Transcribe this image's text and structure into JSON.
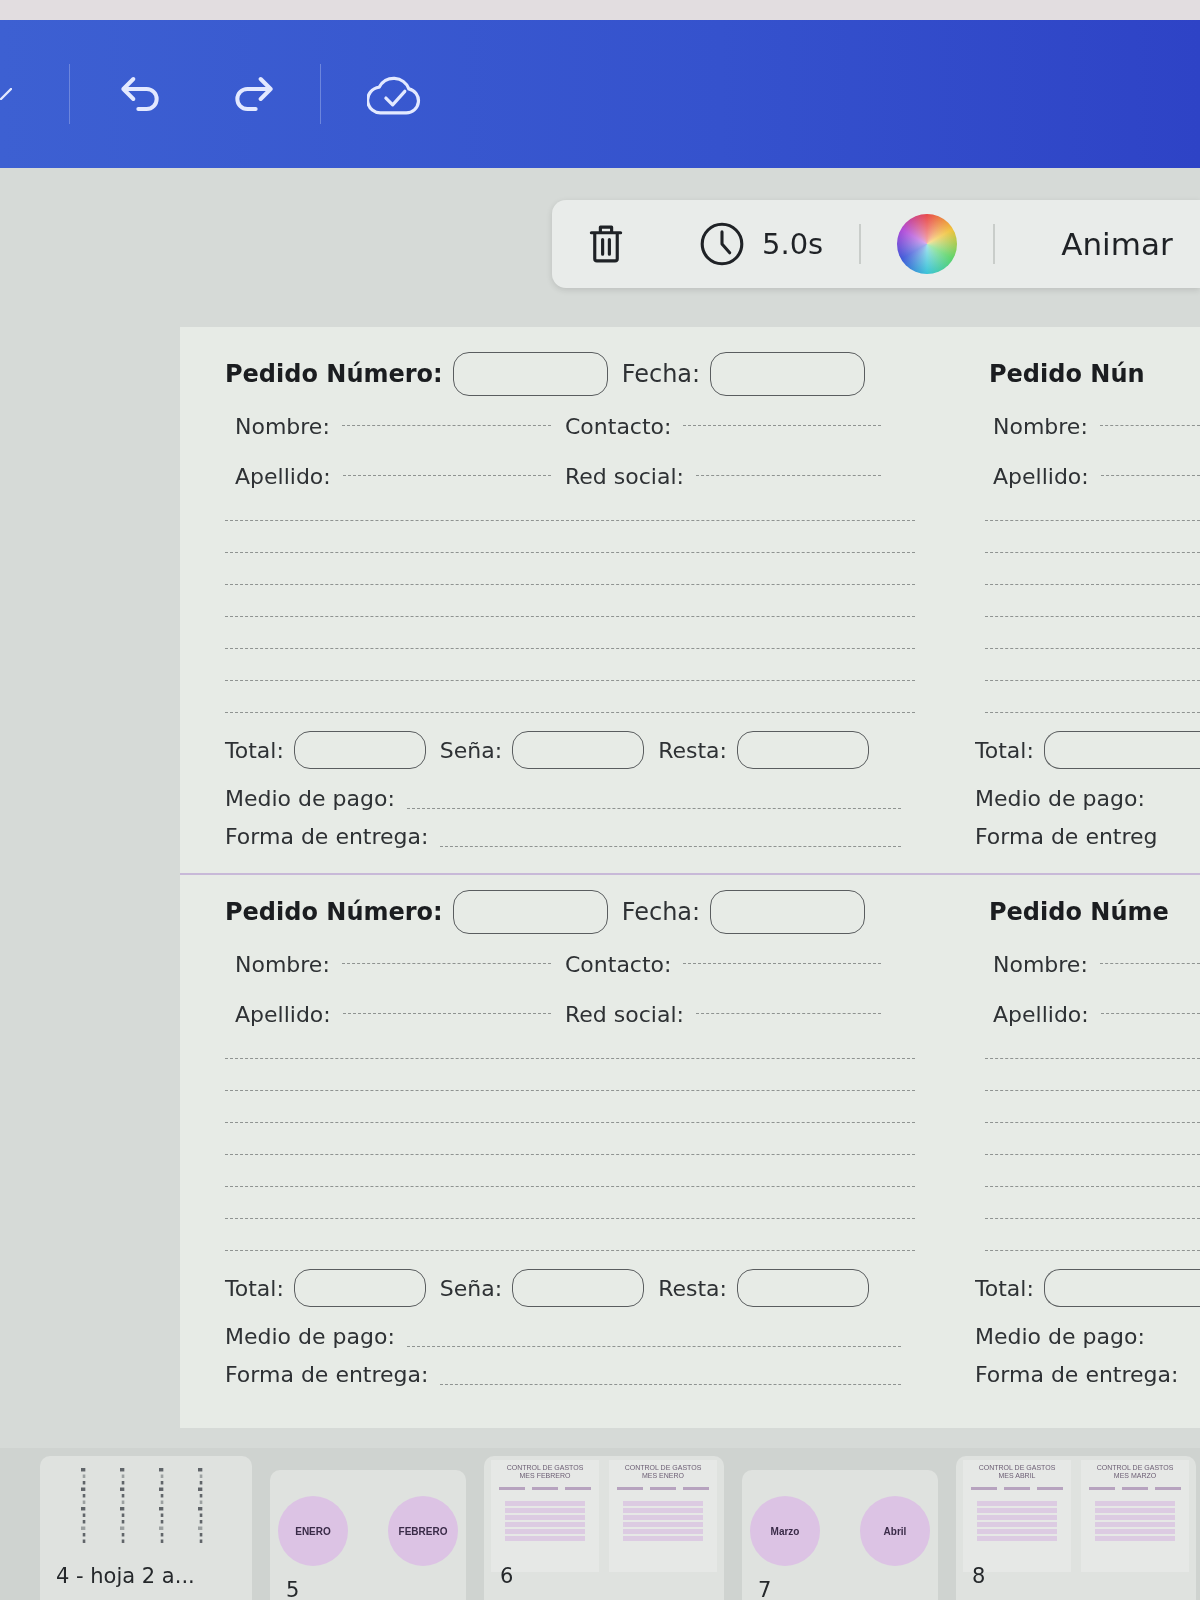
{
  "toolbar": {
    "duration": "5.0s",
    "animate": "Animar"
  },
  "page": {
    "columns": [
      {
        "forms": [
          {
            "kind": "full",
            "title": "Pedido Número:",
            "date_label": "Fecha:",
            "rows": [
              [
                "Nombre:",
                "Contacto:"
              ],
              [
                "Apellido:",
                "Red social:"
              ]
            ],
            "amounts": [
              "Total:",
              "Seña:",
              "Resta:"
            ],
            "footer": [
              "Medio de pago:",
              "Forma de entrega:"
            ]
          },
          {
            "kind": "full",
            "title": "Pedido Número:",
            "date_label": "Fecha:",
            "rows": [
              [
                "Nombre:",
                "Contacto:"
              ],
              [
                "Apellido:",
                "Red social:"
              ]
            ],
            "amounts": [
              "Total:",
              "Seña:",
              "Resta:"
            ],
            "footer": [
              "Medio de pago:",
              "Forma de entrega:"
            ]
          }
        ]
      },
      {
        "forms": [
          {
            "kind": "cut",
            "title": "Pedido Nún",
            "rows": [
              [
                "Nombre:"
              ],
              [
                "Apellido:"
              ]
            ],
            "amounts": [
              "Total:"
            ],
            "footer": [
              "Medio de pago:",
              "Forma de entreg"
            ]
          },
          {
            "kind": "cut",
            "title": "Pedido Núme",
            "rows": [
              [
                "Nombre:"
              ],
              [
                "Apellido:"
              ]
            ],
            "amounts": [
              "Total:"
            ],
            "footer": [
              "Medio de pago:",
              "Forma de entrega:"
            ]
          }
        ]
      }
    ]
  },
  "thumbnails": [
    {
      "kind": "columns",
      "label": "4 - hoja 2 a..."
    },
    {
      "kind": "circles",
      "label": "5",
      "items": [
        "ENERO",
        "FEBRERO"
      ]
    },
    {
      "kind": "sheets",
      "label": "6",
      "items": [
        {
          "title": "CONTROL DE GASTOS",
          "subtitle": "MES FEBRERO"
        },
        {
          "title": "CONTROL DE GASTOS",
          "subtitle": "MES ENERO"
        }
      ]
    },
    {
      "kind": "circles",
      "label": "7",
      "items": [
        "Marzo",
        "Abril"
      ]
    },
    {
      "kind": "sheets",
      "label": "8",
      "items": [
        {
          "title": "CONTROL DE GASTOS",
          "subtitle": "MES ABRIL"
        },
        {
          "title": "CONTROL DE GASTOS",
          "subtitle": "MES MARZO"
        }
      ]
    }
  ]
}
